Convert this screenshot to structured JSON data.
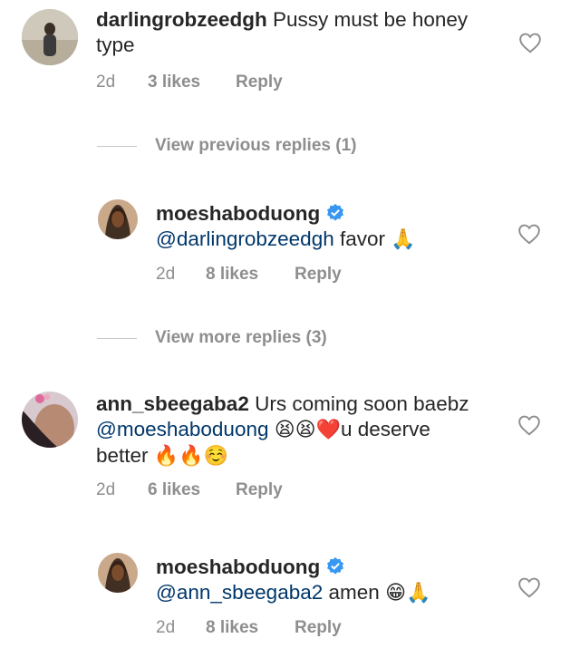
{
  "comments": [
    {
      "username": "darlingrobzeedgh",
      "text": "Pussy must be honey type",
      "age": "2d",
      "likes": "3 likes",
      "reply": "Reply"
    },
    {
      "view_label": "View previous replies (1)"
    },
    {
      "username": "moeshaboduong",
      "mention": "@darlingrobzeedgh",
      "text": "favor",
      "emoji": "🙏",
      "age": "2d",
      "likes": "8 likes",
      "reply": "Reply"
    },
    {
      "view_label": "View more replies (3)"
    },
    {
      "username": "ann_sbeegaba2",
      "text_1": "Urs coming soon baebz",
      "mention": "@moeshaboduong",
      "emoji_1": "😫😫❤️",
      "text_2": "u deserve better",
      "emoji_2": "🔥🔥☺️",
      "age": "2d",
      "likes": "6 likes",
      "reply": "Reply"
    },
    {
      "username": "moeshaboduong",
      "mention": "@ann_sbeegaba2",
      "text": "amen",
      "emoji": "😁🙏",
      "age": "2d",
      "likes": "8 likes",
      "reply": "Reply"
    }
  ],
  "colors": {
    "mention": "#00376b",
    "meta": "#8e8e8e",
    "verified": "#3897f0"
  }
}
